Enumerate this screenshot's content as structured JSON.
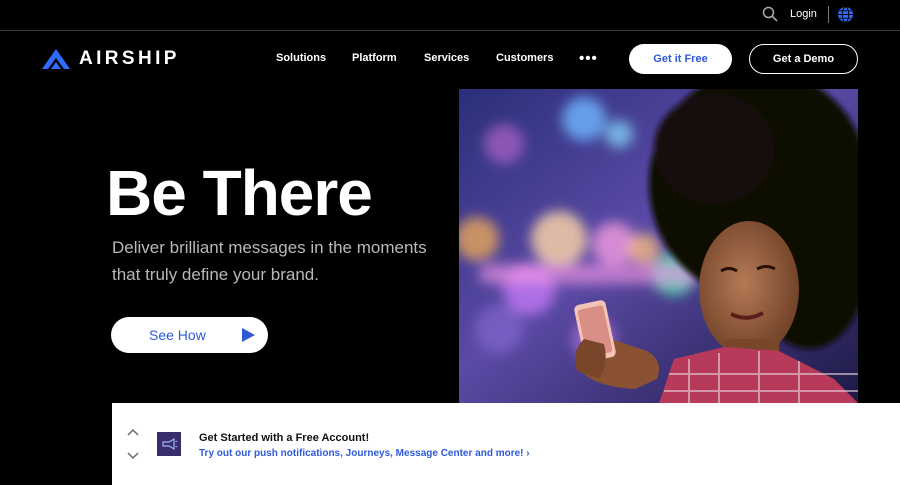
{
  "topbar": {
    "login_label": "Login",
    "icons": [
      "search-icon",
      "globe-icon"
    ]
  },
  "brand": {
    "name": "AIRSHIP",
    "accent_color": "#2e6bff"
  },
  "nav": {
    "items": [
      {
        "label": "Solutions"
      },
      {
        "label": "Platform"
      },
      {
        "label": "Services"
      },
      {
        "label": "Customers"
      }
    ],
    "more_label": "•••",
    "cta_primary": "Get it Free",
    "cta_secondary": "Get a Demo"
  },
  "hero": {
    "title": "Be There",
    "subtitle": "Deliver brilliant messages in the moments that truly define your brand.",
    "button_label": "See How"
  },
  "banner": {
    "title": "Get Started with a Free Account!",
    "link_text": "Try out our push notifications, Journeys, Message Center and more!  ›"
  },
  "colors": {
    "background": "#000000",
    "link_blue": "#2e5ad6",
    "banner_icon_bg": "#3a2d6b"
  }
}
